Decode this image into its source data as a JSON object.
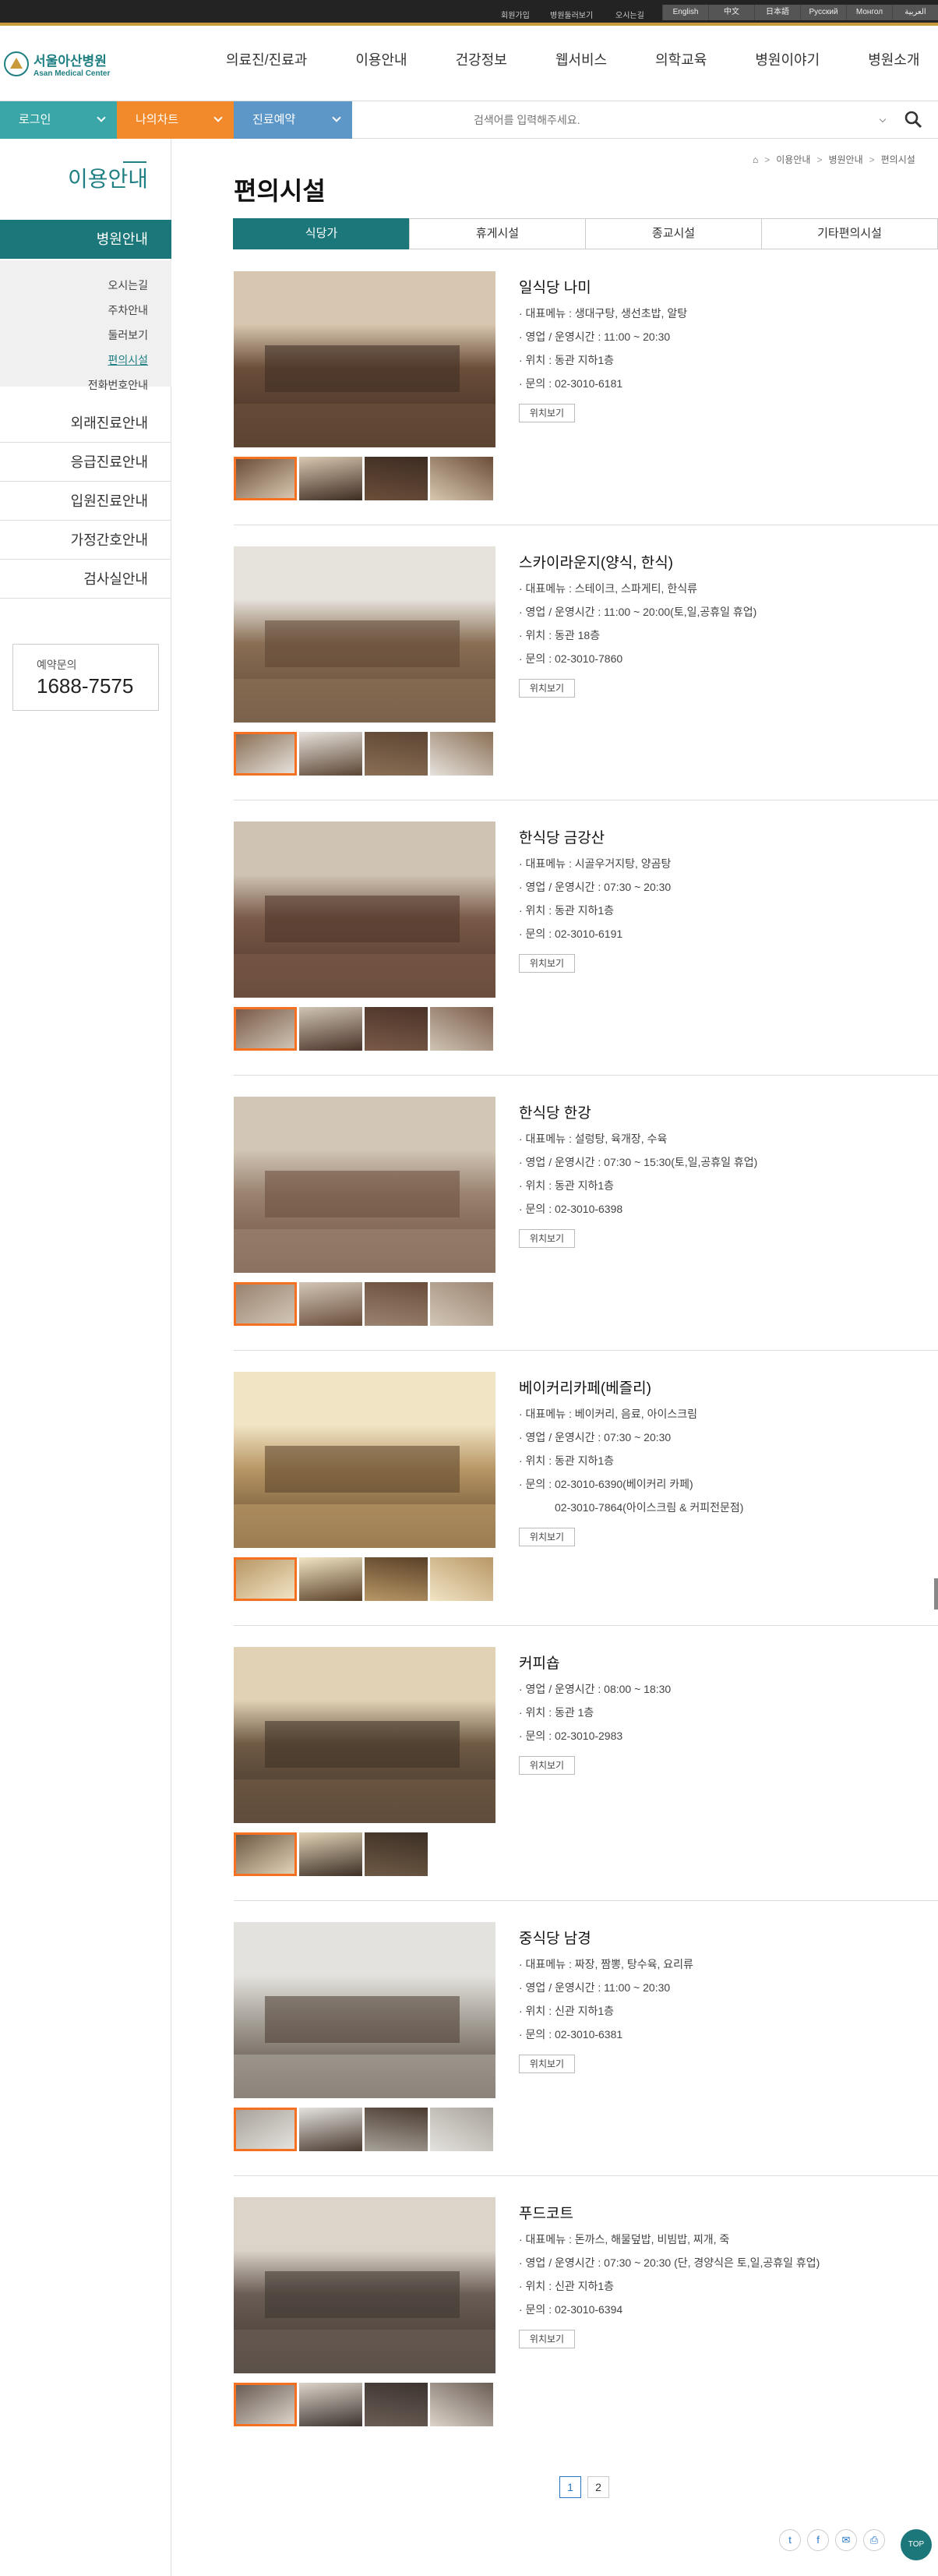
{
  "topbar": {
    "links": [
      "회원가입",
      "병원둘러보기",
      "오시는길"
    ],
    "languages": [
      "English",
      "中文",
      "日本語",
      "Русский",
      "Монгол",
      "العربية"
    ]
  },
  "logo": {
    "name_ko": "서울아산병원",
    "name_en": "Asan Medical Center"
  },
  "gnb": [
    "의료진/진료과",
    "이용안내",
    "건강정보",
    "웹서비스",
    "의학교육",
    "병원이야기",
    "병원소개"
  ],
  "utility": {
    "login": "로그인",
    "navigator": "나의차트",
    "reservation": "진료예약",
    "colors": {
      "login": "#3aa6a8",
      "navigator": "#f28a2c",
      "reservation": "#5c97c8"
    }
  },
  "search": {
    "placeholder": "검색어를 입력해주세요."
  },
  "sidebar": {
    "title": "이용안내",
    "active": "병원안내",
    "sub_items": [
      "오시는길",
      "주차안내",
      "둘러보기",
      "편의시설",
      "전화번호안내"
    ],
    "current_sub": "편의시설",
    "items": [
      "외래진료안내",
      "응급진료안내",
      "입원진료안내",
      "가정간호안내",
      "검사실안내"
    ],
    "reserve_label": "예약문의",
    "reserve_number": "1688-7575"
  },
  "breadcrumb": [
    "이용안내",
    "병원안내",
    "편의시설"
  ],
  "page_title": "편의시설",
  "tabs": [
    "식당가",
    "휴게시설",
    "종교시설",
    "기타편의시설"
  ],
  "active_tab": "식당가",
  "map_button": "위치보기",
  "entries": [
    {
      "name": "일식당 나미",
      "lines": [
        "· 대표메뉴 : 생대구탕, 생선초밥, 알탕",
        "· 영업 / 운영시간 : 11:00 ~ 20:30",
        "· 위치 : 동관 지하1층",
        "· 문의 : 02-3010-6181"
      ]
    },
    {
      "name": "스카이라운지(양식, 한식)",
      "lines": [
        "· 대표메뉴 : 스테이크, 스파게티, 한식류",
        "· 영업 / 운영시간 : 11:00 ~ 20:00(토,일,공휴일 휴업)",
        "· 위치 : 동관 18층",
        "· 문의 : 02-3010-7860"
      ]
    },
    {
      "name": "한식당 금강산",
      "lines": [
        "· 대표메뉴 : 시골우거지탕, 양곰탕",
        "· 영업 / 운영시간 : 07:30 ~ 20:30",
        "· 위치 : 동관 지하1층",
        "· 문의 : 02-3010-6191"
      ]
    },
    {
      "name": "한식당 한강",
      "lines": [
        "· 대표메뉴 : 설렁탕, 육개장, 수육",
        "· 영업 / 운영시간 : 07:30 ~ 15:30(토,일,공휴일 휴업)",
        "· 위치 : 동관 지하1층",
        "· 문의 : 02-3010-6398"
      ]
    },
    {
      "name": "베이커리카페(베즐리)",
      "lines": [
        "· 대표메뉴 : 베이커리, 음료, 아이스크림",
        "· 영업 / 운영시간 : 07:30 ~ 20:30",
        "· 위치 : 동관 지하1층",
        "· 문의 : 02-3010-6390(베이커리 카페)",
        "02-3010-7864(아이스크림 & 커피전문점)"
      ]
    },
    {
      "name": "커피숍",
      "lines": [
        "· 영업 / 운영시간 : 08:00 ~ 18:30",
        "· 위치 : 동관 1층",
        "· 문의 : 02-3010-2983"
      ]
    },
    {
      "name": "중식당 남경",
      "lines": [
        "· 대표메뉴 : 짜장, 짬뽕, 탕수육, 요리류",
        "· 영업 / 운영시간 : 11:00 ~ 20:30",
        "· 위치 : 신관 지하1층",
        "· 문의 : 02-3010-6381"
      ]
    },
    {
      "name": "푸드코트",
      "lines": [
        "· 대표메뉴 : 돈까스, 해물덮밥, 비빔밥, 찌개, 죽",
        "· 영업 / 운영시간 : 07:30 ~ 20:30 (단, 경양식은 토,일,공휴일 휴업)",
        "· 위치 : 신관 지하1층",
        "· 문의 : 02-3010-6394"
      ]
    }
  ],
  "pagination": [
    "1",
    "2"
  ],
  "current_page": "1",
  "share": [
    "t",
    "f",
    "✉",
    "⎙"
  ],
  "top_button": "TOP"
}
